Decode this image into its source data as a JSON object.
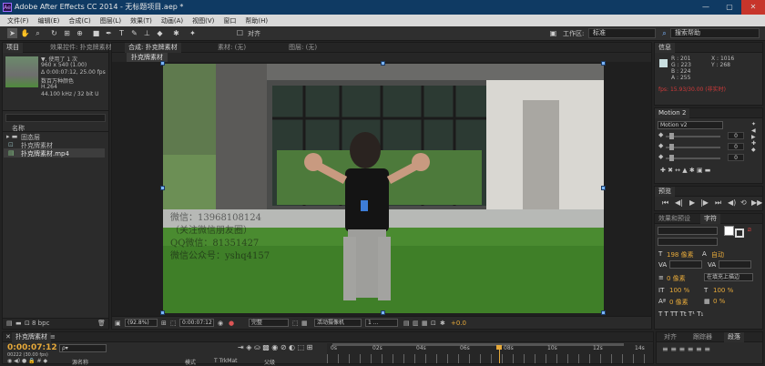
{
  "window": {
    "title": "Adobe After Effects CC 2014 - 无标题项目.aep *",
    "app_icon": "Ae",
    "minimize": "—",
    "maximize": "▢",
    "close": "✕"
  },
  "menu": [
    "文件(F)",
    "编辑(E)",
    "合成(C)",
    "图层(L)",
    "效果(T)",
    "动画(A)",
    "视图(V)",
    "窗口",
    "帮助(H)"
  ],
  "toolbar": {
    "align_label": "对齐",
    "workspace_label": "工作区:",
    "workspace_value": "标准",
    "search_placeholder": "搜索帮助"
  },
  "project_panel": {
    "tabs": [
      "项目",
      "效果控件: 扑克牌素材"
    ],
    "info_lines": [
      "▼, 使用了 1 次",
      "960 x 540 (1.00)",
      "Δ 0:00:07:12, 25.00 fps",
      "数百万种颜色",
      "H.264",
      "44.100 kHz / 32 bit U"
    ],
    "name_header": "名称",
    "items": [
      "固态层",
      "扑克牌素材",
      "扑克牌素材.mp4"
    ],
    "bpc": "8 bpc"
  },
  "comp_panel": {
    "tabs": [
      "合成: 扑克牌素材",
      "素材: (无)",
      "图层: (无)"
    ],
    "breadcrumb": "扑克牌素材",
    "zoom": "(92.8%)",
    "timecode": "0:00:07:12",
    "quality": "完整",
    "camera": "活动摄像机",
    "views": "1 ...",
    "exposure": "+0.0"
  },
  "info_panel": {
    "tab": "信息",
    "r": "R : 201",
    "g": "G : 223",
    "b": "B : 224",
    "a": "A : 255",
    "x": "X : 1016",
    "y": "Y : 268",
    "fps_warning": "fps: 15.93/30.00 (非实时)",
    "swatch_color": "#c9dfe0"
  },
  "motion_panel": {
    "tab": "Motion 2",
    "preset": "Motion v2",
    "values": [
      "0",
      "0",
      "0"
    ]
  },
  "preview_panel": {
    "tab": "预览"
  },
  "effects_panel": {
    "tabs": [
      "效果和预设",
      "字符"
    ]
  },
  "character_panel": {
    "font_size": "198 像素",
    "leading": "自动",
    "kerning": "0 像素",
    "stroke_label": "在填充上描边",
    "v_scale": "100 %",
    "h_scale": "100 %",
    "baseline": "0 像素",
    "tsume": "0 %"
  },
  "bottom_right_tabs": [
    "对齐",
    "跟踪器",
    "段落"
  ],
  "timeline": {
    "tab": "扑克牌素材",
    "timecode": "0:00:07:12",
    "frame_info": "00222 (30.00 fps)",
    "search_placeholder": "ρ▾",
    "col_source": "源名称",
    "col_mode": "模式",
    "col_trkmat": "T TrkMat",
    "col_parent": "父级",
    "ruler": [
      "0s",
      "02s",
      "04s",
      "06s",
      "08s",
      "10s",
      "12s",
      "14s"
    ]
  },
  "watermark": [
    "微信：13968108124",
    "（关注微信朋友圈）",
    "QQ微信：81351427",
    "微信公众号：yshq4157"
  ],
  "colors": {
    "accent": "#7ab5ff",
    "playhead": "#e6a93a",
    "timecode": "#e6a93a",
    "fps_warning": "#d03a3a",
    "titlebar": "#0f3a63"
  }
}
